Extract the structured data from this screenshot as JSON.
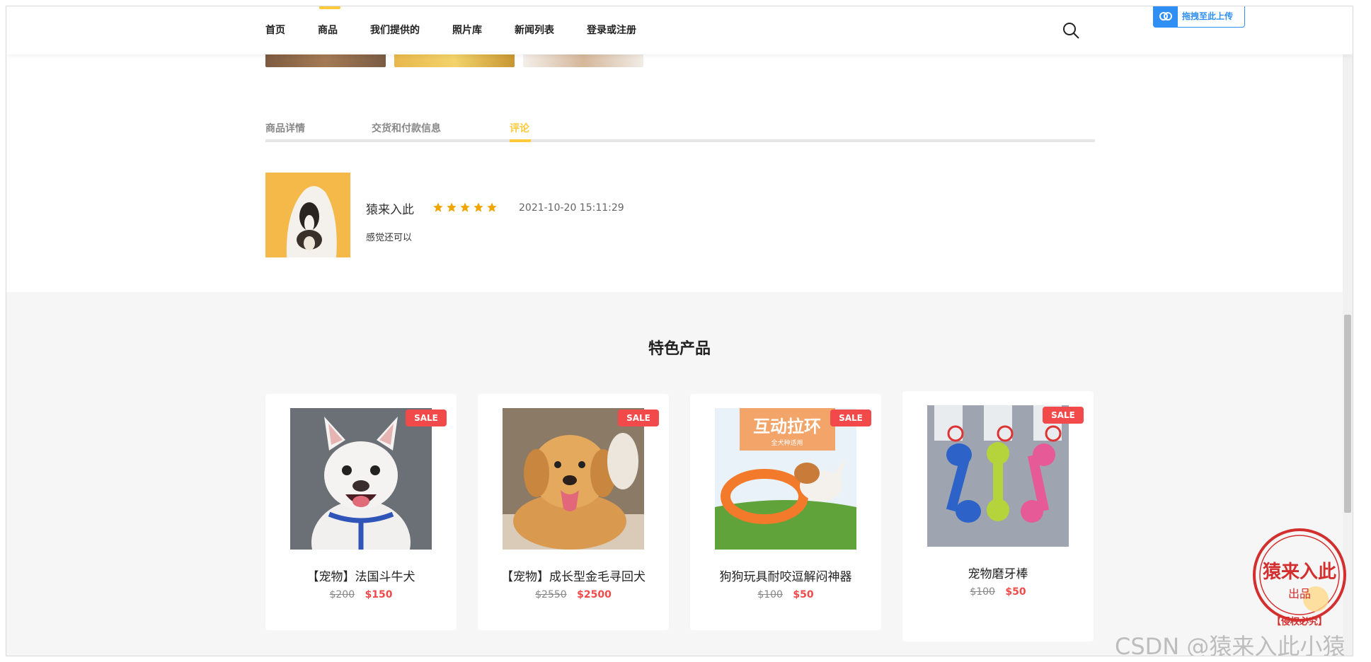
{
  "nav": {
    "items": [
      "首页",
      "商品",
      "我们提供的",
      "照片库",
      "新闻列表",
      "登录或注册"
    ],
    "active_index": 1,
    "search_icon": "search-icon",
    "upload_label": "拖拽至此上传"
  },
  "tabs": {
    "items": [
      "商品详情",
      "交货和付款信息",
      "评论"
    ],
    "active_index": 2
  },
  "review": {
    "name": "猿来入此",
    "rating": 5,
    "time": "2021-10-20 15:11:29",
    "text": "感觉还可以"
  },
  "featured": {
    "title": "特色产品",
    "sale_label": "SALE",
    "products": [
      {
        "title": "【宠物】法国斗牛犬",
        "old_price": "$200",
        "price": "$150"
      },
      {
        "title": "【宠物】成长型金毛寻回犬",
        "old_price": "$2550",
        "price": "$2500"
      },
      {
        "title": "狗狗玩具耐咬逗解闷神器",
        "old_price": "$100",
        "price": "$50",
        "banner_text": "互动拉环",
        "banner_sub": "全犬种适用"
      },
      {
        "title": "宠物磨牙棒",
        "old_price": "$100",
        "price": "$50"
      }
    ]
  },
  "watermark": "CSDN @猿来入此小猿",
  "stamp": {
    "main": "猿来入此",
    "sub": "出品",
    "footer": "【侵权必究】"
  },
  "colors": {
    "accent": "#ffc93c",
    "sale": "#f2494a",
    "upload": "#2f8ff5",
    "stamp": "#d32f2f"
  }
}
